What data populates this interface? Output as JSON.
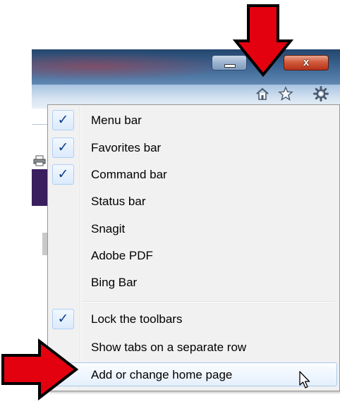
{
  "window": {
    "close_glyph": "x"
  },
  "toolbar": {
    "icons": [
      "home-icon",
      "favorites-star-icon",
      "tools-gear-icon"
    ]
  },
  "menu": {
    "items": [
      {
        "label": "Menu bar",
        "checked": true
      },
      {
        "label": "Favorites bar",
        "checked": true
      },
      {
        "label": "Command bar",
        "checked": true
      },
      {
        "label": "Status bar",
        "checked": false
      },
      {
        "label": "Snagit",
        "checked": false
      },
      {
        "label": "Adobe PDF",
        "checked": false
      },
      {
        "label": "Bing Bar",
        "checked": false
      },
      {
        "label": "Lock the toolbars",
        "checked": true
      },
      {
        "label": "Show tabs on a separate row",
        "checked": false
      },
      {
        "label": "Add or change home page",
        "checked": false,
        "highlighted": true
      }
    ],
    "check_glyph": "✓"
  },
  "colors": {
    "arrow": "#e3000f",
    "arrow_outline": "#000000",
    "check": "#0c3e8a",
    "highlight_border": "#a8c9ee"
  }
}
